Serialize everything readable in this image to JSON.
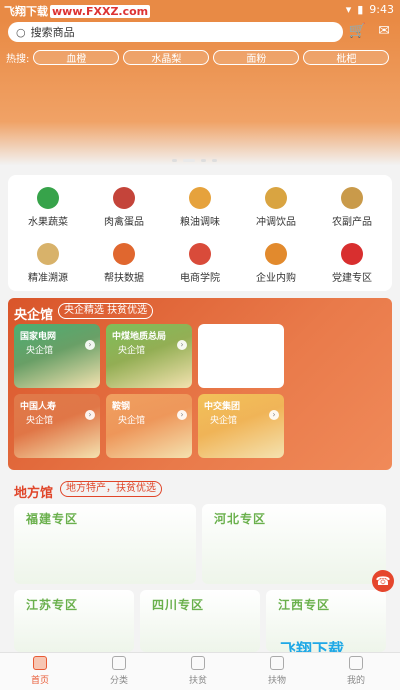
{
  "status": {
    "brand": "飞翔下载",
    "brand_url": "www.FXXZ.com",
    "time": "9:43"
  },
  "search": {
    "placeholder": "搜索商品"
  },
  "hot": {
    "label": "热搜:",
    "items": [
      "血橙",
      "水晶梨",
      "面粉",
      "枇杷"
    ]
  },
  "categories": [
    {
      "label": "水果蔬菜",
      "icon": "fruit-veg-icon",
      "color": "#37a34a"
    },
    {
      "label": "肉禽蛋品",
      "icon": "meat-icon",
      "color": "#c4443a"
    },
    {
      "label": "粮油调味",
      "icon": "oil-icon",
      "color": "#e6a23c"
    },
    {
      "label": "冲调饮品",
      "icon": "drink-icon",
      "color": "#d9a441"
    },
    {
      "label": "农副产品",
      "icon": "farm-icon",
      "color": "#c99a4a"
    },
    {
      "label": "精准溯源",
      "icon": "trace-icon",
      "color": "#d8b26a"
    },
    {
      "label": "帮扶数据",
      "icon": "data-icon",
      "color": "#e0672f"
    },
    {
      "label": "电商学院",
      "icon": "school-icon",
      "color": "#d94b3a"
    },
    {
      "label": "企业内购",
      "icon": "purchase-icon",
      "color": "#e28a2d"
    },
    {
      "label": "党建专区",
      "icon": "party-icon",
      "color": "#d82f2f"
    }
  ],
  "yangqi": {
    "title": "央企馆",
    "tag": "央企精选 扶贫优选",
    "cards": [
      {
        "t1": "国家电网",
        "t2": "央企馆",
        "color": "#4caf73"
      },
      {
        "t1": "中煤地质总局",
        "t2": "央企馆",
        "color": "#7fbf5a"
      },
      {
        "t1": "",
        "t2": "",
        "color": "#ffffff"
      },
      {
        "t1": "中国人寿",
        "t2": "央企馆",
        "color": "#e07a4a"
      },
      {
        "t1": "鞍钢",
        "t2": "央企馆",
        "color": "#f0a060"
      },
      {
        "t1": "中交集团",
        "t2": "央企馆",
        "color": "#f2c25a"
      }
    ]
  },
  "difang": {
    "title": "地方馆",
    "tag": "地方特产，扶贫优选",
    "regions": [
      {
        "name": "福建专区",
        "color": "#6ab04c"
      },
      {
        "name": "河北专区",
        "color": "#6ab04c"
      },
      {
        "name": "江苏专区",
        "color": "#6ab04c"
      },
      {
        "name": "四川专区",
        "color": "#6ab04c"
      },
      {
        "name": "江西专区",
        "color": "#6ab04c"
      }
    ]
  },
  "tabs": [
    {
      "label": "首页",
      "active": true
    },
    {
      "label": "分类",
      "active": false
    },
    {
      "label": "扶贫",
      "active": false
    },
    {
      "label": "扶物",
      "active": false
    },
    {
      "label": "我的",
      "active": false
    }
  ],
  "watermark": "飞翔下载 FXXZ.com"
}
